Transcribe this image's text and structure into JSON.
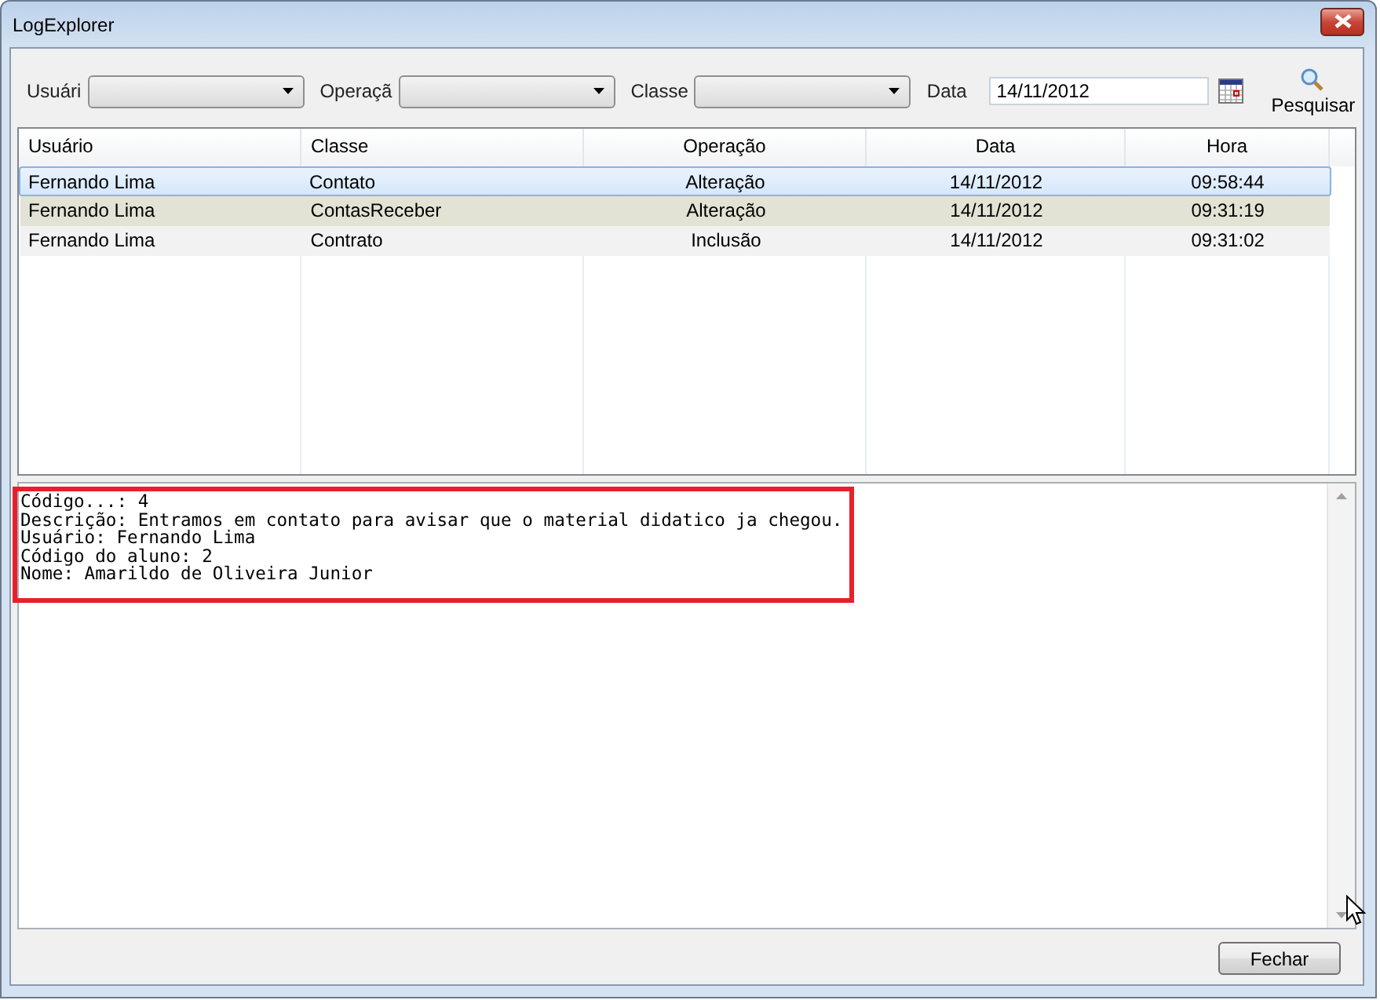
{
  "window": {
    "title": "LogExplorer"
  },
  "filters": [
    {
      "kind": "combo",
      "label": "Usuári"
    },
    {
      "kind": "combo",
      "label": "Operaçã"
    },
    {
      "kind": "combo",
      "label": "Classe"
    },
    {
      "kind": "date",
      "label": "Data",
      "value": "14/11/2012"
    }
  ],
  "search_button": {
    "label": "Pesquisar"
  },
  "table": {
    "columns": [
      "Usuário",
      "Classe",
      "Operação",
      "Data",
      "Hora"
    ],
    "rows": [
      {
        "selected": true,
        "cells": [
          "Fernando Lima",
          "Contato",
          "Alteração",
          "14/11/2012",
          "09:58:44"
        ]
      },
      {
        "selected": false,
        "cells": [
          "Fernando Lima",
          "ContasReceber",
          "Alteração",
          "14/11/2012",
          "09:31:19"
        ]
      },
      {
        "selected": false,
        "cells": [
          "Fernando Lima",
          "Contrato",
          "Inclusão",
          "14/11/2012",
          "09:31:02"
        ]
      }
    ]
  },
  "details": {
    "highlighted": true,
    "lines": [
      "Código...: 4",
      "Descrição: Entramos em contato para avisar que o material didatico ja chegou.",
      "Usuário: Fernando Lima",
      "Código do aluno: 2",
      "Nome: Amarildo de Oliveira Junior"
    ]
  },
  "buttons": [
    "Fechar"
  ]
}
